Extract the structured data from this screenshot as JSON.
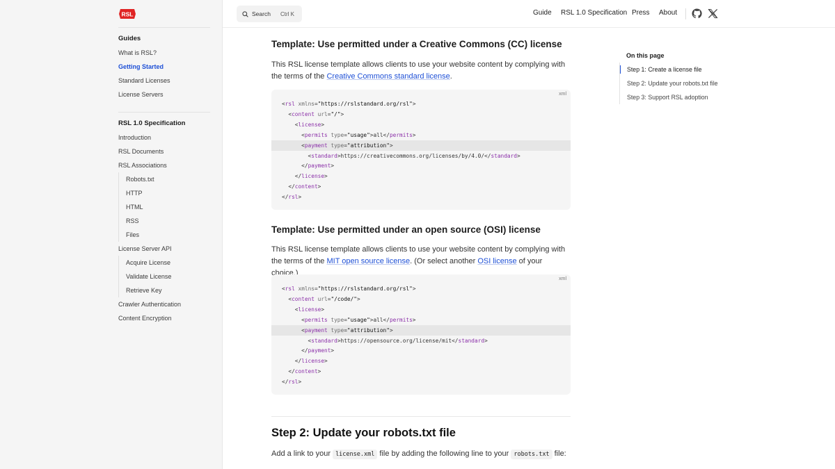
{
  "sidebar": {
    "logo_text": "RSL",
    "guides_head": "Guides",
    "guides": [
      {
        "label": "What is RSL?"
      },
      {
        "label": "Getting Started",
        "active": true
      },
      {
        "label": "Standard Licenses"
      },
      {
        "label": "License Servers"
      }
    ],
    "spec_head": "RSL 1.0 Specification",
    "spec_items": [
      {
        "label": "Introduction"
      },
      {
        "label": "RSL Documents"
      },
      {
        "label": "RSL Associations"
      }
    ],
    "assoc_sub": [
      "Robots.txt",
      "HTTP",
      "HTML",
      "RSS",
      "Files"
    ],
    "api_label": "License Server API",
    "api_sub": [
      "Acquire License",
      "Validate License",
      "Retrieve Key"
    ],
    "tail_items": [
      "Crawler Authentication",
      "Content Encryption"
    ]
  },
  "topbar": {
    "search_label": "Search",
    "search_shortcut": "Ctrl K",
    "nav": [
      "Guide",
      "RSL 1.0 Specification",
      "Press",
      "About"
    ],
    "icons": [
      "github-icon",
      "x-twitter-icon"
    ]
  },
  "main": {
    "cc_heading": "Template: Use permitted under a Creative Commons (CC) license",
    "cc_para_pre": "This RSL license template allows clients to use your website content by complying with the terms of the ",
    "cc_link": "Creative Commons standard license",
    "cc_para_post": ".",
    "code_lang": "xml",
    "cc_code": [
      "<rsl xmlns=\"https://rslstandard.org/rsl\">",
      "  <content url=\"/\">",
      "    <license>",
      "      <permits type=\"usage\">all</permits>",
      "      <payment type=\"attribution\">",
      "        <standard>https://creativecommons.org/licenses/by/4.0/</standard>",
      "      </payment>",
      "    </license>",
      "  </content>",
      "</rsl>"
    ],
    "osi_heading": "Template: Use permitted under an open source (OSI) license",
    "osi_para_pre": "This RSL license template allows clients to use your website content by complying with the terms of the ",
    "osi_link1": "MIT open source license",
    "osi_para_mid": ". (Or select another ",
    "osi_link2": "OSI license",
    "osi_para_post": " of your choice.)",
    "osi_code": [
      "<rsl xmlns=\"https://rslstandard.org/rsl\">",
      "  <content url=\"/code/\">",
      "    <license>",
      "      <permits type=\"usage\">all</permits>",
      "      <payment type=\"attribution\">",
      "        <standard>https://opensource.org/license/mit</standard>",
      "      </payment>",
      "    </license>",
      "  </content>",
      "</rsl>"
    ],
    "step2_heading": "Step 2: Update your robots.txt file",
    "step2_pre": "Add a link to your ",
    "step2_code1": "license.xml",
    "step2_mid": " file by adding the following line to your ",
    "step2_code2": "robots.txt",
    "step2_post": " file:"
  },
  "toc": {
    "title": "On this page",
    "items": [
      {
        "label": "Step 1: Create a license file",
        "active": true
      },
      {
        "label": "Step 2: Update your robots.txt file"
      },
      {
        "label": "Step 3: Support RSL adoption"
      }
    ]
  },
  "colors": {
    "accent": "#1d4fd6",
    "tag": "#8a2ea8",
    "sidebar_bg": "#f5f5f5",
    "code_bg": "#f5f5f5"
  }
}
